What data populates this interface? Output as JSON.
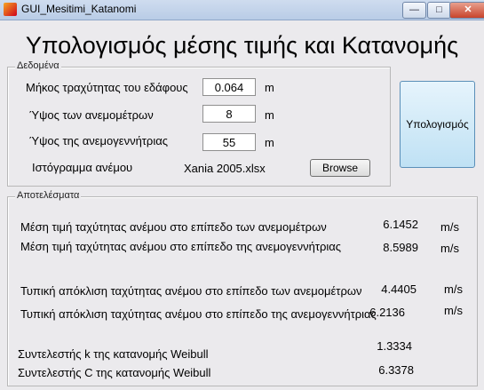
{
  "window": {
    "title": "GUI_Mesitimi_Katanomi",
    "minimize_symbol": "—",
    "maximize_symbol": "□",
    "close_symbol": "✕"
  },
  "heading": "Υπολογισμός μέσης τιμής και Κατανομής",
  "inputs_panel": {
    "title": "Δεδομένα",
    "rows": [
      {
        "label": "Μήκος τραχύτητας του εδάφους",
        "value": "0.064",
        "unit": "m"
      },
      {
        "label": "Ύψος των ανεμομέτρων",
        "value": "8",
        "unit": "m"
      },
      {
        "label": "Ύψος της ανεμογεννήτριας",
        "value": "55",
        "unit": "m"
      }
    ],
    "histogram_label": "Ιστόγραμμα ανέμου",
    "histogram_file": "Xania 2005.xlsx",
    "browse_label": "Browse"
  },
  "calculate_label": "Υπολογισμός",
  "results_panel": {
    "title": "Αποτελέσματα",
    "rows": [
      {
        "label": "Μέση τιμή ταχύτητας ανέμου στο επίπεδο των ανεμομέτρων",
        "value": "6.1452",
        "unit": "m/s"
      },
      {
        "label": "Μέση τιμή ταχύτητας ανέμου στο επίπεδο της ανεμογεννήτριας",
        "value": "8.5989",
        "unit": "m/s"
      },
      {
        "label": "Τυπική απόκλιση ταχύτητας ανέμου στο επίπεδο των ανεμομέτρων",
        "value": "4.4405",
        "unit": "m/s"
      },
      {
        "label": "Τυπική απόκλιση ταχύτητας ανέμου στο επίπεδο της ανεμογεννήτριας",
        "value": "6.2136",
        "unit": "m/s"
      },
      {
        "label": "Συντελεστής k της κατανομής Weibull",
        "value": "1.3334",
        "unit": ""
      },
      {
        "label": "Συντελεστής C της κατανομής Weibull",
        "value": "6.3378",
        "unit": ""
      }
    ]
  }
}
